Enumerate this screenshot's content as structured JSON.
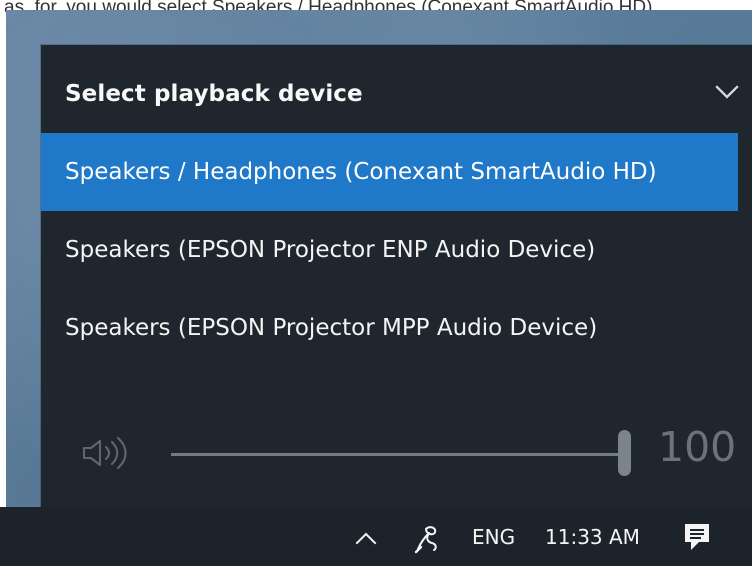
{
  "document_background": {
    "top_snippet": "as, for, you would select Speakers / Headphones (Conexant SmartAudio HD)"
  },
  "audio_flyout": {
    "title": "Select playback device",
    "expand_icon": "chevron-down-icon",
    "devices": [
      {
        "label": "Speakers / Headphones (Conexant SmartAudio HD)",
        "selected": true
      },
      {
        "label": "Speakers (EPSON Projector ENP Audio Device)",
        "selected": false
      },
      {
        "label": "Speakers (EPSON Projector MPP Audio Device)",
        "selected": false
      }
    ],
    "volume": {
      "icon": "speaker-icon",
      "value": "100",
      "level_percent": 100
    }
  },
  "taskbar": {
    "show_hidden_icon": "chevron-up-icon",
    "network_icon": "network-icon",
    "language": "ENG",
    "time": "11:33 AM",
    "notification_icon": "notification-icon"
  },
  "colors": {
    "flyout_background": "#20262d",
    "selected_background": "#1f78c8",
    "taskbar_background": "#1d232a",
    "muted_text": "#6a727b"
  }
}
